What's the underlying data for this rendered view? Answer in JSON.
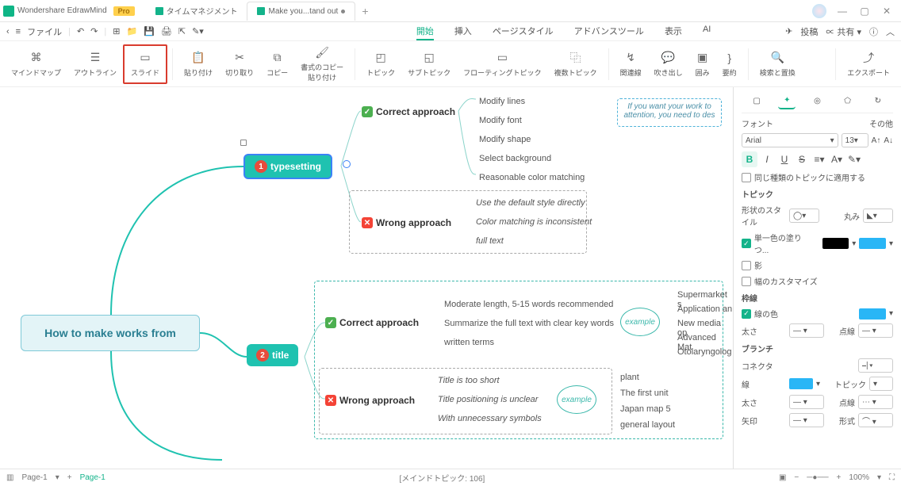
{
  "app": {
    "name": "Wondershare EdrawMind",
    "pro": "Pro"
  },
  "tabs": [
    {
      "label": "タイムマネジメント"
    },
    {
      "label": "Make you...tand out",
      "active": true
    }
  ],
  "menu": {
    "file": "ファイル",
    "tabs": [
      "開始",
      "挿入",
      "ページスタイル",
      "アドバンスツール",
      "表示",
      "AI"
    ],
    "post": "投稿",
    "share": "共有"
  },
  "ribbon": {
    "mindmap": "マインドマップ",
    "outline": "アウトライン",
    "slide": "スライド",
    "paste": "貼り付け",
    "cut": "切り取り",
    "copy": "コピー",
    "fmtpaste": "書式のコピー\n貼り付け",
    "topic": "トピック",
    "subtopic": "サブトピック",
    "floating": "フローティングトピック",
    "multi": "複数トピック",
    "relation": "関連線",
    "blow": "吹き出し",
    "summary": "囲み",
    "digest": "要約",
    "search": "検索と置換",
    "export": "エクスポート"
  },
  "map": {
    "root": "How to make works from",
    "typesetting": "typesetting",
    "title": "title",
    "correct": "Correct approach",
    "wrong": "Wrong approach",
    "t1": [
      "Modify lines",
      "Modify font",
      "Modify shape",
      "Select background",
      "Reasonable color matching"
    ],
    "t2": [
      "Use the default style directly",
      "Color matching is inconsistent",
      "full text"
    ],
    "t3": [
      "Moderate length, 5-15 words recommended",
      "Summarize the full text with clear key words",
      "written terms"
    ],
    "t4": [
      "Title is too short",
      "Title positioning is unclear",
      "With unnecessary symbols"
    ],
    "ex": "example",
    "ex1": [
      "Supermarket s",
      "Application an",
      "New media op",
      "Advanced Mat",
      "Otolaryngolog"
    ],
    "ex2": [
      "plant",
      "The first unit",
      "Japan map 5",
      "general layout"
    ],
    "callout": "If you want your work to attention, you need to des"
  },
  "panel": {
    "font_h": "フォント",
    "other": "その他",
    "font": "Arial",
    "size": "13",
    "sametype": "同じ種類のトピックに適用する",
    "topic_h": "トピック",
    "shape_style": "形状のスタイル",
    "round": "丸み",
    "fill": "単一色の塗りつ...",
    "shadow": "影",
    "width_custom": "幅のカスタマイズ",
    "border_h": "枠線",
    "border_color": "線の色",
    "thick": "太さ",
    "dashed": "点線",
    "branch_h": "ブランチ",
    "connector": "コネクタ",
    "line": "線",
    "topic_l": "トピック",
    "arrow": "矢印",
    "shape": "形式"
  },
  "status": {
    "page": "Page-1",
    "page2": "Page-1",
    "center": "[メインドトピック: 106]",
    "zoom": "100%"
  }
}
